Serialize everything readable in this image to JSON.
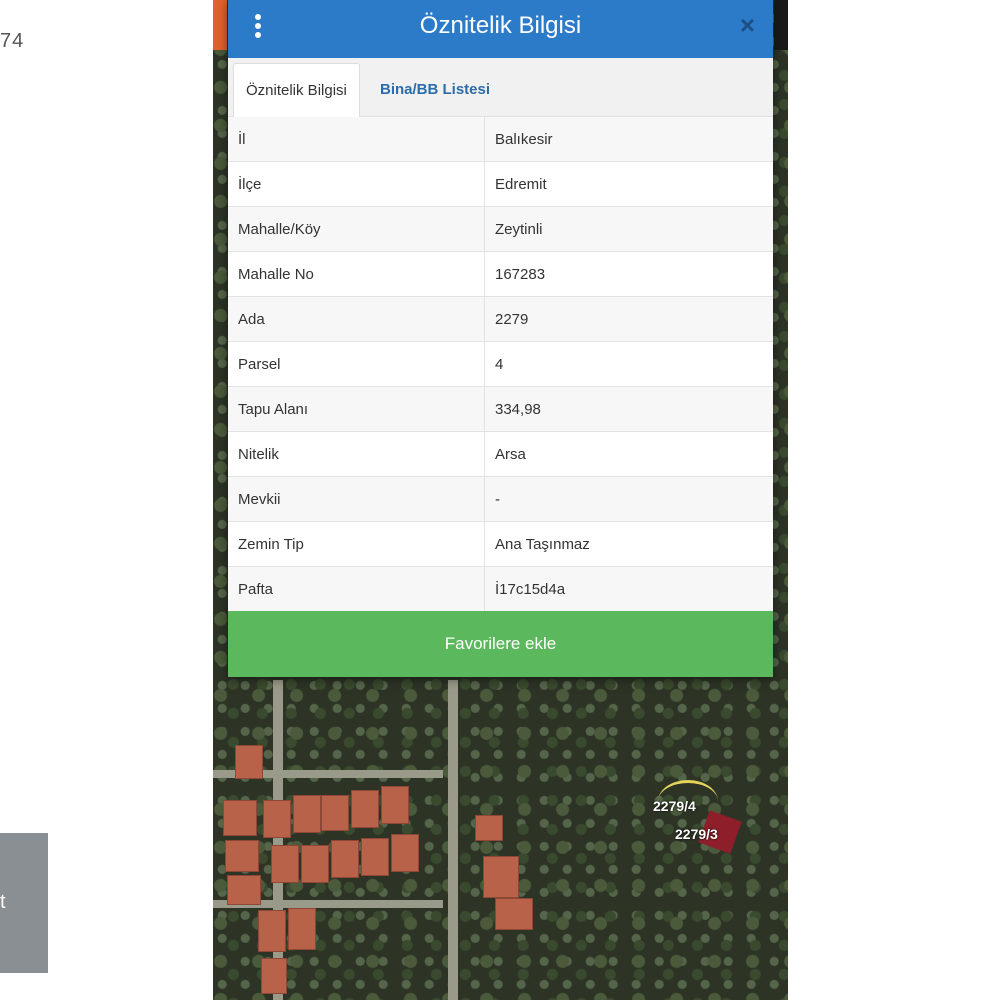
{
  "left_edge": {
    "number_fragment": "74",
    "card_fragment": "t"
  },
  "dialog": {
    "title": "Öznitelik Bilgisi",
    "close_glyph": "×",
    "tabs": [
      {
        "label": "Öznitelik Bilgisi",
        "active": true
      },
      {
        "label": "Bina/BB Listesi",
        "active": false
      }
    ],
    "rows": [
      {
        "key": "İl",
        "value": "Balıkesir"
      },
      {
        "key": "İlçe",
        "value": "Edremit"
      },
      {
        "key": "Mahalle/Köy",
        "value": "Zeytinli"
      },
      {
        "key": "Mahalle No",
        "value": "167283"
      },
      {
        "key": "Ada",
        "value": "2279"
      },
      {
        "key": "Parsel",
        "value": "4"
      },
      {
        "key": "Tapu Alanı",
        "value": "334,98"
      },
      {
        "key": "Nitelik",
        "value": "Arsa"
      },
      {
        "key": "Mevkii",
        "value": "-"
      },
      {
        "key": "Zemin Tip",
        "value": "Ana Taşınmaz"
      },
      {
        "key": "Pafta",
        "value": "İ17c15d4a"
      }
    ],
    "favorite_button": "Favorilere ekle"
  },
  "map": {
    "labels": [
      "2279/4",
      "2279/3"
    ]
  },
  "colors": {
    "header": "#2c7bc8",
    "favorite": "#5cb85c",
    "tab_link": "#2c6ca8"
  },
  "icons": {
    "menu": "vertical-dots-icon",
    "close": "close-icon"
  }
}
